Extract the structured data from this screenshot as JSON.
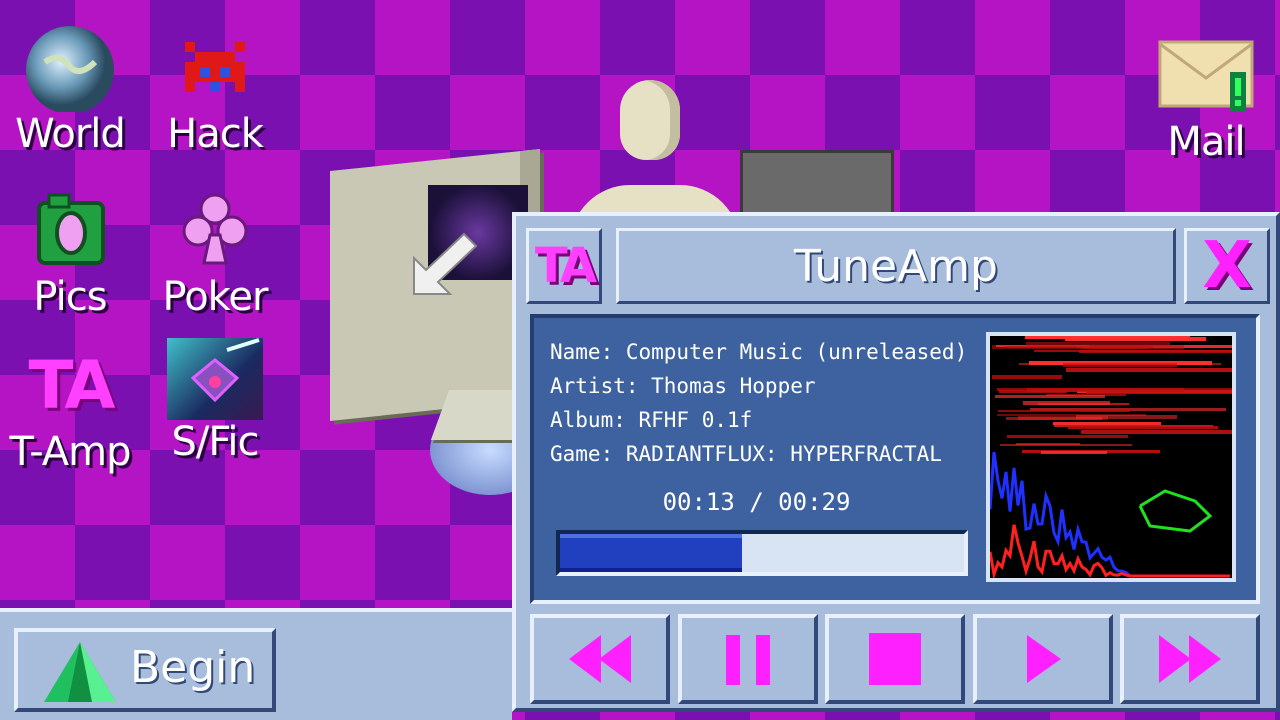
{
  "desktop": {
    "icons": [
      {
        "label": "World"
      },
      {
        "label": "Hack"
      },
      {
        "label": "Pics"
      },
      {
        "label": "Poker"
      },
      {
        "label": "T-Amp"
      },
      {
        "label": "S/Fic"
      },
      {
        "label": "Mail"
      }
    ]
  },
  "window": {
    "title": "TuneAmp",
    "logo_text": "TA",
    "close_label": "X",
    "track": {
      "name": "Name: Computer Music (unreleased)",
      "artist": "Artist: Thomas Hopper",
      "album": "Album: RFHF 0.1f",
      "game": "Game: RADIANTFLUX: HYPERFRACTAL"
    },
    "time": "00:13 / 00:29",
    "progress": 0.45,
    "controls": [
      "rewind",
      "pause",
      "stop",
      "play",
      "fast-forward"
    ]
  },
  "taskbar": {
    "begin_label": "Begin"
  },
  "colors": {
    "accent": "#ff20ff",
    "window_bg": "#a8bcdc",
    "panel_bg": "#3e62a0",
    "progress_fill": "#2040c0",
    "checker_a": "#7a10b0",
    "checker_b": "#b414c4"
  }
}
